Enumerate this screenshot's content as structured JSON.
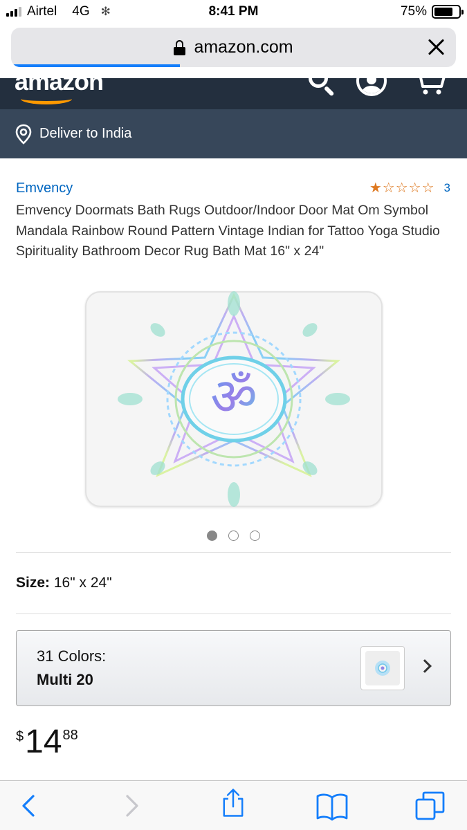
{
  "status_bar": {
    "carrier": "Airtel",
    "network": "4G",
    "time": "8:41 PM",
    "battery": "75%",
    "battery_level": 0.75,
    "signal_bars": 3
  },
  "browser": {
    "url": "amazon.com",
    "load_progress": 0.38
  },
  "header": {
    "logo": "amazon",
    "deliver_to": "Deliver to India"
  },
  "product": {
    "brand": "Emvency",
    "rating_stars": 1,
    "rating_count": "3",
    "title": "Emvency Doormats Bath Rugs Outdoor/Indoor Door Mat Om Symbol Mandala Rainbow Round Pattern Vintage Indian for Tattoo Yoga Studio Spirituality Bathroom Decor Rug Bath Mat 16\" x 24\"",
    "image_count": 3,
    "active_image": 0,
    "size_label": "Size:",
    "size_value": "16\" x 24\"",
    "colors_label": "31 Colors:",
    "colors_value": "Multi 20",
    "price_symbol": "$",
    "price_whole": "14",
    "price_fraction": "88"
  },
  "colors": {
    "amazon_dark": "#232f3e",
    "amazon_sub": "#37475a",
    "amazon_orange": "#ff9900",
    "link_blue": "#0066c0",
    "ios_blue": "#147efb"
  }
}
